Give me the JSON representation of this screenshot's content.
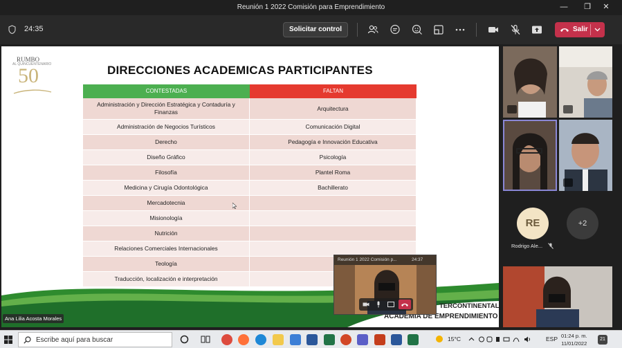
{
  "window": {
    "title": "Reunión 1 2022 Comisión para Emprendimiento"
  },
  "toolbar": {
    "timer": "24:35",
    "control_label": "Solicitar control",
    "leave_label": "Salir"
  },
  "slide": {
    "title": "DIRECCIONES ACADEMICAS PARTICIPANTES",
    "logo": {
      "line1": "RUMBO",
      "line2": "AL QUINCUENTENARIO",
      "line3": "50"
    },
    "headers": {
      "left": "CONTESTADAS",
      "right": "FALTAN"
    },
    "rows": [
      {
        "left": "Administración y Dirección Estratégica y Contaduría y Finanzas",
        "right": "Arquitectura"
      },
      {
        "left": "Administración de Negocios Turísticos",
        "right": "Comunicación Digital"
      },
      {
        "left": "Derecho",
        "right": "Pedagogía e Innovación Educativa"
      },
      {
        "left": "Diseño Gráfico",
        "right": "Psicología"
      },
      {
        "left": "Filosofía",
        "right": "Plantel Roma"
      },
      {
        "left": "Medicina y Cirugía Odontológica",
        "right": "Bachillerato"
      },
      {
        "left": "Mercadotecnia",
        "right": ""
      },
      {
        "left": "Misionología",
        "right": ""
      },
      {
        "left": "Nutrición",
        "right": ""
      },
      {
        "left": "Relaciones Comerciales Internacionales",
        "right": ""
      },
      {
        "left": "Teología",
        "right": ""
      },
      {
        "left": "Traducción, localización e interpretación",
        "right": ""
      }
    ],
    "brand_line1": "TERCONTINENTAL",
    "brand_line2": "ACADEMIA DE EMPRENDIMIENTO",
    "presenter": "Ana Lilia Acosta Morales"
  },
  "gallery": {
    "avatar_initials": "RE",
    "more_count": "+2",
    "participant_name": "Rodrigo Ale..."
  },
  "popup": {
    "title": "Reunión 1 2022 Comisión p...",
    "timer": "24:37"
  },
  "taskbar": {
    "search_placeholder": "Escribe aquí para buscar",
    "temperature": "15°C",
    "language": "ESP",
    "time": "01:24 p. m.",
    "date": "11/01/2022",
    "notifications": "21"
  },
  "colors": {
    "leave": "#c4314b",
    "header_green": "#4caf50",
    "header_red": "#e53a2f"
  }
}
